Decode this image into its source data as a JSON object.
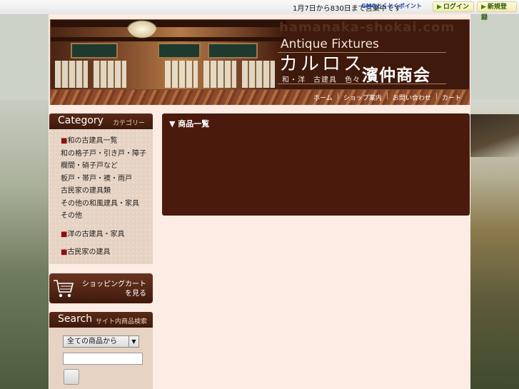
{
  "topbar": {
    "notice": "1月7日から830日まで営業中です",
    "gmo_logo": "GMOとくとくポイント",
    "login_label": "ログイン",
    "register_label": "新規登録"
  },
  "header": {
    "watermark": "hamanaka-shokai.com",
    "antique": "Antique Fixtures",
    "carlos": "カルロス",
    "tagline": "和・洋　古建具　色々",
    "shop_name": "濱仲商会"
  },
  "nav": {
    "links": [
      "ホーム",
      "ショップ案内",
      "お問い合わせ",
      "カート"
    ]
  },
  "sidebar": {
    "category_title_en": "Category",
    "category_title_jp": "カテゴリー",
    "groups": [
      [
        "■和の古建具一覧",
        "和の格子戸・引き戸・障子",
        "欄間・硝子戸など",
        "板戸・帯戸・襖・雨戸",
        "古民家の建具類",
        "その他の和風建具・家具",
        "その他"
      ],
      [
        "■洋の古建具・家具"
      ],
      [
        "■古民家の建具"
      ]
    ],
    "cart_label": "ショッピングカートを見る",
    "search_title_en": "Search",
    "search_title_jp": "サイト内商品検索",
    "search_select_value": "全ての商品から",
    "search_input_value": "",
    "colors": {
      "accent": "#3e190c",
      "panel": "#e7d3c4"
    }
  },
  "main": {
    "title": "▼ 商品一覧"
  }
}
